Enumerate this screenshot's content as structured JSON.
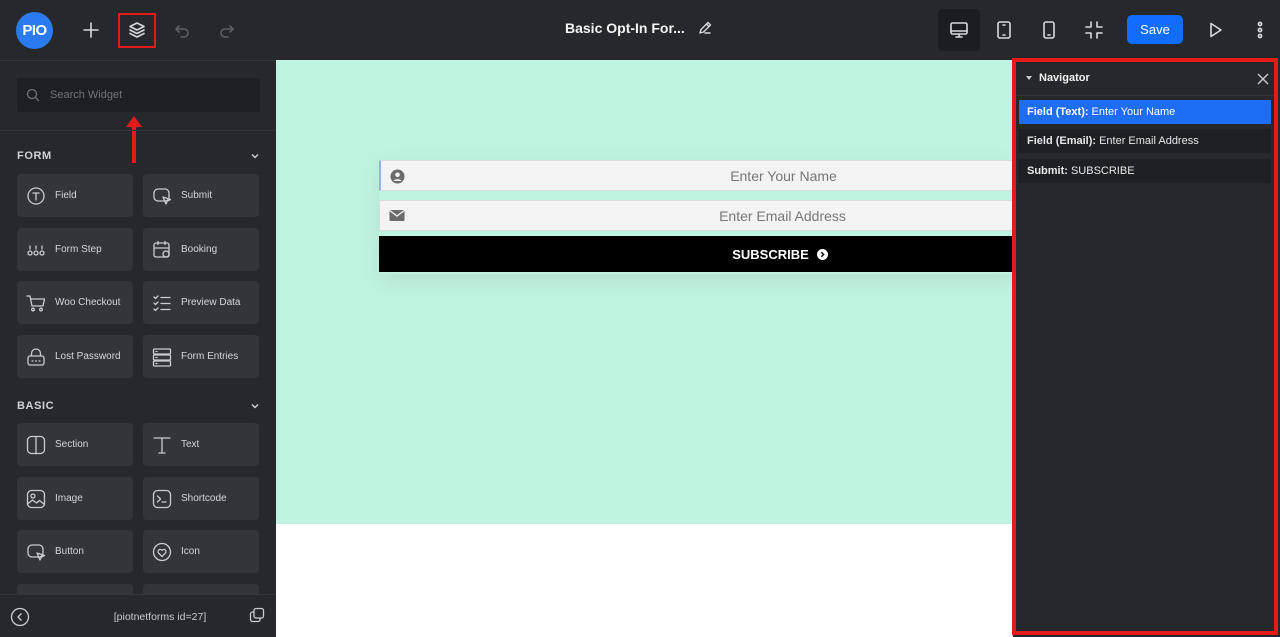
{
  "topbar": {
    "logo_text": "PIO",
    "document_title": "Basic Opt-In For...",
    "save_label": "Save"
  },
  "sidebar": {
    "search_placeholder": "Search Widget",
    "sections": [
      {
        "title": "FORM",
        "widgets": [
          {
            "label": "Field",
            "icon": "field-icon"
          },
          {
            "label": "Submit",
            "icon": "submit-icon"
          },
          {
            "label": "Form Step",
            "icon": "form-step-icon"
          },
          {
            "label": "Booking",
            "icon": "booking-icon"
          },
          {
            "label": "Woo Checkout",
            "icon": "cart-icon"
          },
          {
            "label": "Preview Data",
            "icon": "checklist-icon"
          },
          {
            "label": "Lost Password",
            "icon": "lock-icon"
          },
          {
            "label": "Form Entries",
            "icon": "entries-icon"
          }
        ]
      },
      {
        "title": "BASIC",
        "widgets": [
          {
            "label": "Section",
            "icon": "section-icon"
          },
          {
            "label": "Text",
            "icon": "text-icon"
          },
          {
            "label": "Image",
            "icon": "image-icon"
          },
          {
            "label": "Shortcode",
            "icon": "shortcode-icon"
          },
          {
            "label": "Button",
            "icon": "button-icon"
          },
          {
            "label": "Icon",
            "icon": "heart-icon"
          }
        ]
      }
    ],
    "footer_shortcode": "[piotnetforms id=27]"
  },
  "canvas": {
    "name_placeholder": "Enter Your Name",
    "email_placeholder": "Enter Email Address",
    "submit_label": "SUBSCRIBE",
    "bg_color": "#bff4e0"
  },
  "navigator": {
    "title": "Navigator",
    "items": [
      {
        "type": "Field (Text):",
        "value": "Enter Your Name",
        "active": true
      },
      {
        "type": "Field (Email):",
        "value": "Enter Email Address",
        "active": false
      },
      {
        "type": "Submit:",
        "value": "SUBSCRIBE",
        "active": false
      }
    ]
  },
  "colors": {
    "accent": "#116dff",
    "highlight_red": "#e31b1b",
    "panel": "#26282b"
  }
}
